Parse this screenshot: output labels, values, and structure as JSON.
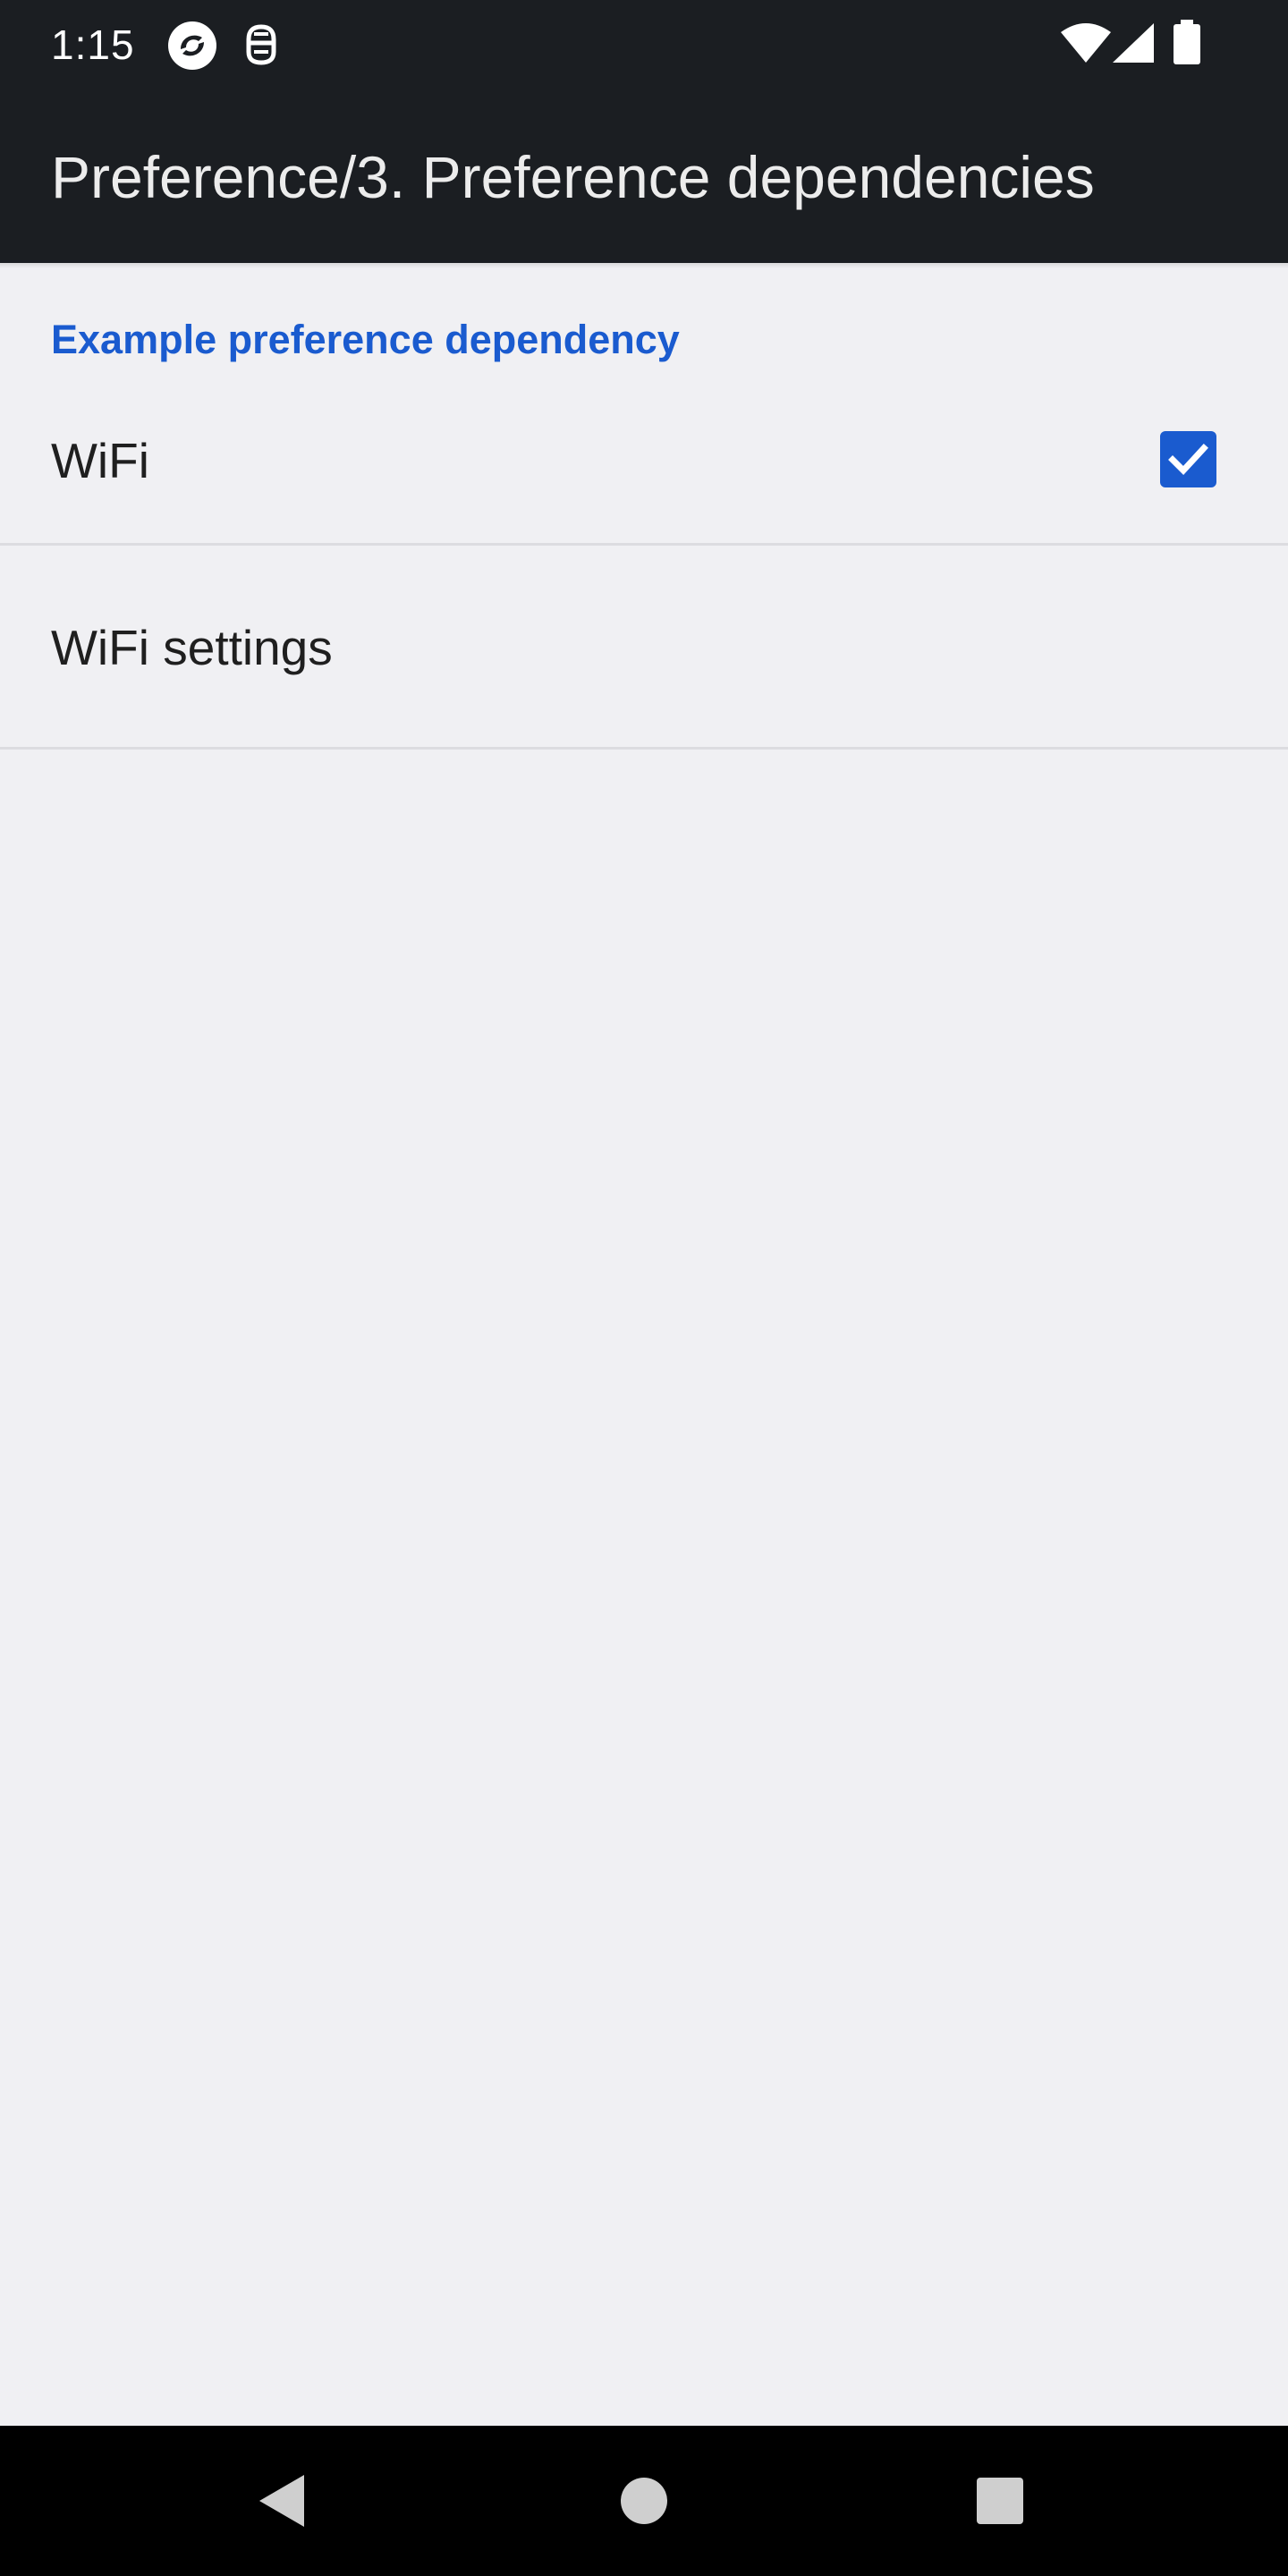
{
  "status_bar": {
    "time": "1:15",
    "left_icons": [
      "sync-app-icon",
      "notification-app-icon"
    ],
    "right_icons": [
      "wifi-signal-icon",
      "cellular-signal-icon",
      "battery-icon"
    ]
  },
  "app_bar": {
    "title": "Preference/3. Preference dependencies"
  },
  "preferences": {
    "category_title": "Example preference dependency",
    "wifi": {
      "label": "WiFi",
      "checked": true
    },
    "wifi_settings": {
      "label": "WiFi settings"
    }
  },
  "nav_bar": {
    "buttons": [
      "back-icon",
      "home-icon",
      "recents-icon"
    ]
  },
  "colors": {
    "accent": "#1a5bcf",
    "app_bar_bg": "#1b1e22",
    "page_bg": "#f0f0f3",
    "nav_bg": "#000000"
  }
}
